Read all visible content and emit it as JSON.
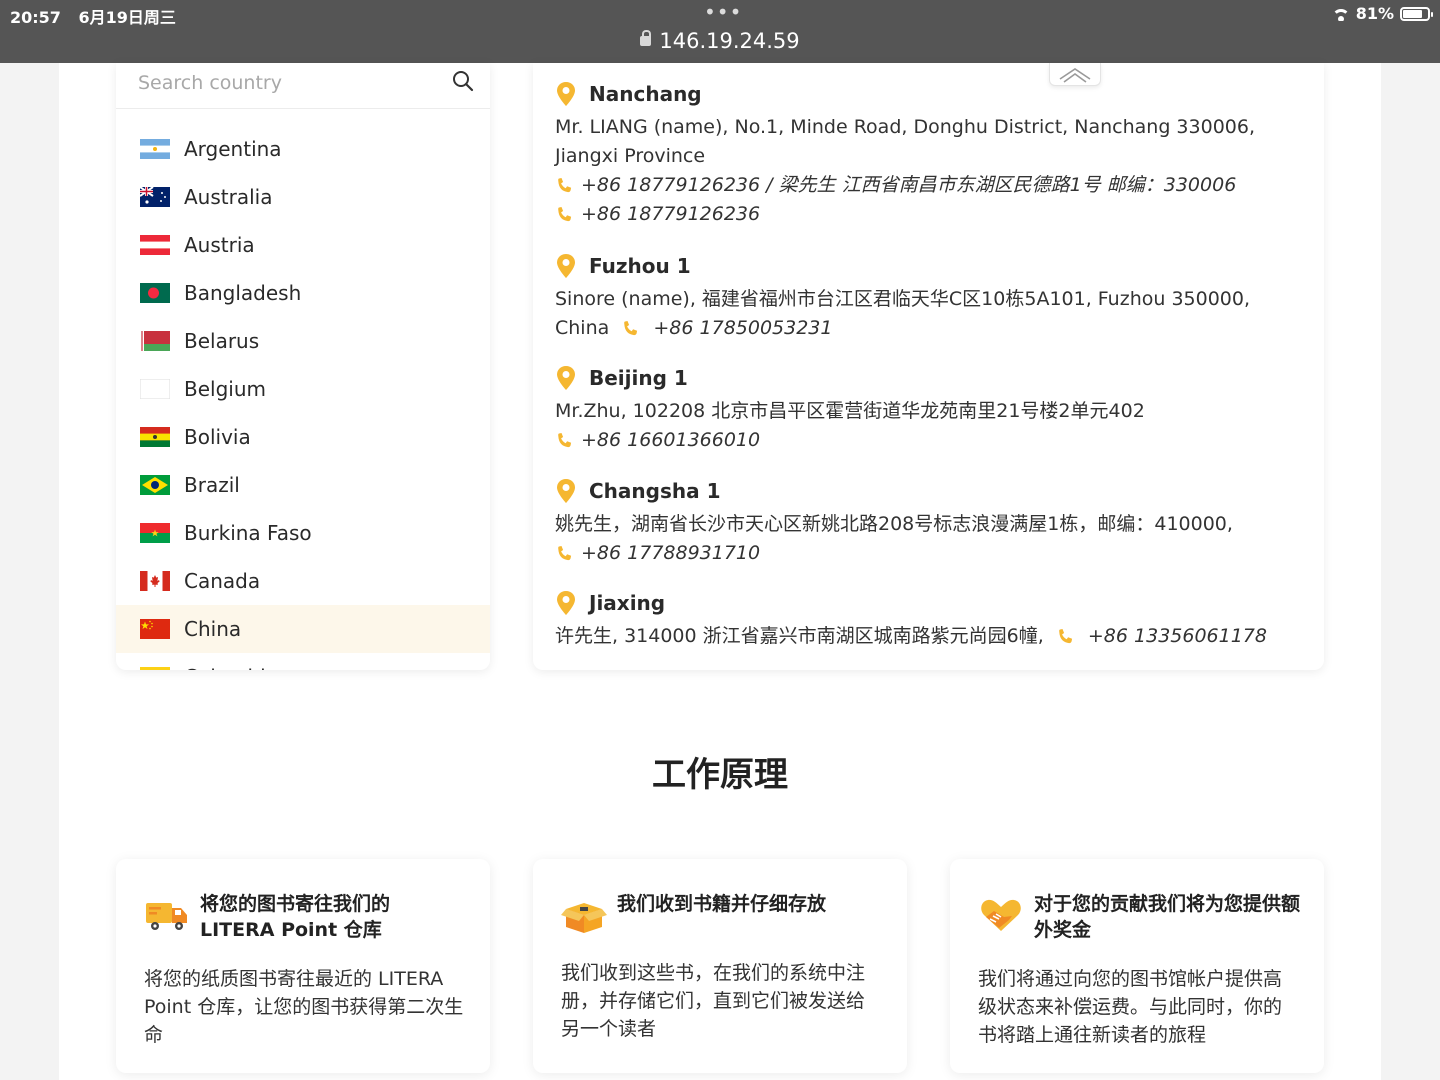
{
  "status_bar": {
    "time": "20:57",
    "date": "6月19日周三",
    "battery": "81%",
    "battery_level": 0.81,
    "dots": "•••"
  },
  "browser": {
    "url": "146.19.24.59"
  },
  "search": {
    "placeholder": "Search country"
  },
  "countries": [
    {
      "name": "Argentina",
      "flag": "argentina"
    },
    {
      "name": "Australia",
      "flag": "australia"
    },
    {
      "name": "Austria",
      "flag": "austria"
    },
    {
      "name": "Bangladesh",
      "flag": "bangladesh"
    },
    {
      "name": "Belarus",
      "flag": "belarus"
    },
    {
      "name": "Belgium",
      "flag": "belgium"
    },
    {
      "name": "Bolivia",
      "flag": "bolivia"
    },
    {
      "name": "Brazil",
      "flag": "brazil"
    },
    {
      "name": "Burkina Faso",
      "flag": "burkina-faso"
    },
    {
      "name": "Canada",
      "flag": "canada"
    },
    {
      "name": "China",
      "flag": "china",
      "selected": true
    },
    {
      "name": "Colombia",
      "flag": "colombia"
    }
  ],
  "addresses": [
    {
      "city": "Nanchang",
      "line1": "Mr. LIANG (name), No.1, Minde Road, Donghu District, Nanchang 330006,",
      "line2": "Jiangxi Province",
      "phone1": "+86 18779126236 / 梁先生 江西省南昌市东湖区民德路1号 邮编：330006",
      "phone2": "+86 18779126236"
    },
    {
      "city": "Fuzhou 1",
      "line1": "Sinore (name), 福建省福州市台江区君临天华C区10栋5A101, Fuzhou 350000,",
      "line2": "China",
      "phone1": "+86 17850053231"
    },
    {
      "city": "Beijing 1",
      "line1": "Mr.Zhu, 102208 北京市昌平区霍营街道华龙苑南里21号楼2单元402",
      "phone1": "+86 16601366010"
    },
    {
      "city": "Changsha 1",
      "line1": "姚先生，湖南省长沙市天心区新姚北路208号标志浪漫满屋1栋，邮编：410000,",
      "phone1": "+86 17788931710"
    },
    {
      "city": "Jiaxing",
      "line1": "许先生, 314000 浙江省嘉兴市南湖区城南路紫元尚园6幢,",
      "phone1": "+86 13356061178"
    }
  ],
  "how_it_works": {
    "title": "工作原理",
    "steps": [
      {
        "icon": "delivery-truck-icon",
        "title": "将您的图书寄往我们的 LITERA Point 仓库",
        "description": "将您的纸质图书寄往最近的 LITERA Point 仓库，让您的图书获得第二次生命"
      },
      {
        "icon": "open-box-icon",
        "title": "我们收到书籍并仔细存放",
        "description": "我们收到这些书，在我们的系统中注册，并存储它们，直到它们被发送给另一个读者"
      },
      {
        "icon": "heart-hand-icon",
        "title": "对于您的贡献我们将为您提供额外奖金",
        "description": "我们将通过向您的图书馆帐户提供高级状态来补偿运费。与此同时，你的书将踏上通往新读者的旅程"
      }
    ]
  },
  "colors": {
    "accent": "#f5b731",
    "top_bar": "#555555",
    "selected_row": "#fdf7ea",
    "page_bg": "#f3f3f3"
  }
}
